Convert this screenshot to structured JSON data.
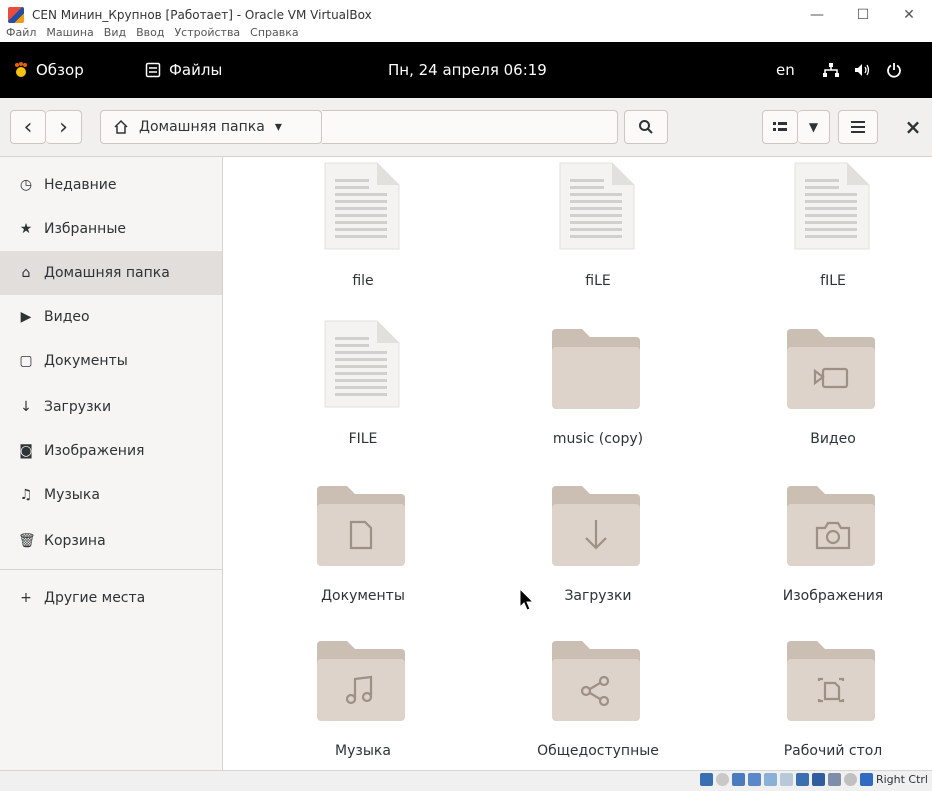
{
  "host": {
    "title": "CEN Минин_Крупнов [Работает] - Oracle VM VirtualBox",
    "menu": [
      "Файл",
      "Машина",
      "Вид",
      "Ввод",
      "Устройства",
      "Справка"
    ],
    "controls": {
      "minimize": "—",
      "maximize": "☐",
      "close": "✕"
    },
    "status_text": "Right Ctrl"
  },
  "topbar": {
    "activities": "Обзор",
    "app": "Файлы",
    "clock": "Пн, 24 апреля  06:19",
    "lang": "en"
  },
  "headerbar": {
    "back": "‹",
    "forward": "›",
    "path": "Домашняя папка",
    "path_dropdown": "▾",
    "search_icon": "search-icon",
    "view_icon": "list-view-icon",
    "close": "×"
  },
  "sidebar": {
    "items": [
      {
        "label": "Недавние",
        "icon": "clock-icon",
        "glyph": "◷"
      },
      {
        "label": "Избранные",
        "icon": "star-icon",
        "glyph": "★"
      },
      {
        "label": "Домашняя папка",
        "icon": "home-icon",
        "glyph": "⌂"
      },
      {
        "label": "Видео",
        "icon": "video-icon",
        "glyph": "▶"
      },
      {
        "label": "Документы",
        "icon": "document-icon",
        "glyph": "▢"
      },
      {
        "label": "Загрузки",
        "icon": "download-icon",
        "glyph": "↓"
      },
      {
        "label": "Изображения",
        "icon": "camera-icon",
        "glyph": "◙"
      },
      {
        "label": "Музыка",
        "icon": "music-icon",
        "glyph": "♫"
      },
      {
        "label": "Корзина",
        "icon": "trash-icon",
        "glyph": "🗑"
      }
    ],
    "other": {
      "label": "Другие места",
      "glyph": "+"
    }
  },
  "files": [
    {
      "name": "file",
      "kind": "document"
    },
    {
      "name": "fiLE",
      "kind": "document"
    },
    {
      "name": "fILE",
      "kind": "document"
    },
    {
      "name": "FILE",
      "kind": "document"
    },
    {
      "name": "music (copy)",
      "kind": "folder"
    },
    {
      "name": "Видео",
      "kind": "folder-video"
    },
    {
      "name": "Документы",
      "kind": "folder-documents"
    },
    {
      "name": "Загрузки",
      "kind": "folder-download"
    },
    {
      "name": "Изображения",
      "kind": "folder-pictures"
    },
    {
      "name": "Музыка",
      "kind": "folder-music"
    },
    {
      "name": "Общедоступные",
      "kind": "folder-public"
    },
    {
      "name": "Рабочий стол",
      "kind": "folder-desktop"
    }
  ],
  "colors": {
    "folder_back": "#cbbfb4",
    "folder_front": "#ddd3ca",
    "folder_emblem": "#9e9085",
    "doc_body": "#f4f3f1",
    "doc_lines": "#d2d0cd"
  }
}
